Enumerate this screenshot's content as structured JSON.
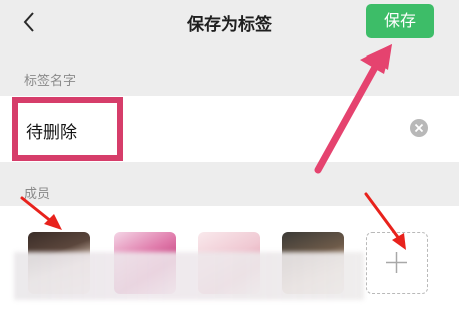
{
  "header": {
    "back_icon": "chevron-left-icon",
    "title": "保存为标签",
    "save_label": "保存"
  },
  "tag_name": {
    "section_label": "标签名字",
    "value": "待删除",
    "clear_icon": "clear-x-circle-icon"
  },
  "members": {
    "section_label": "成员",
    "add_icon": "plus-icon",
    "avatars": [
      "member-1",
      "member-2",
      "member-3",
      "member-4"
    ]
  },
  "colors": {
    "save_button": "#3dbd68",
    "highlight": "#d63d6a",
    "arrow_pink": "#e5436f",
    "arrow_red": "#e8221c",
    "background": "#ededed"
  }
}
